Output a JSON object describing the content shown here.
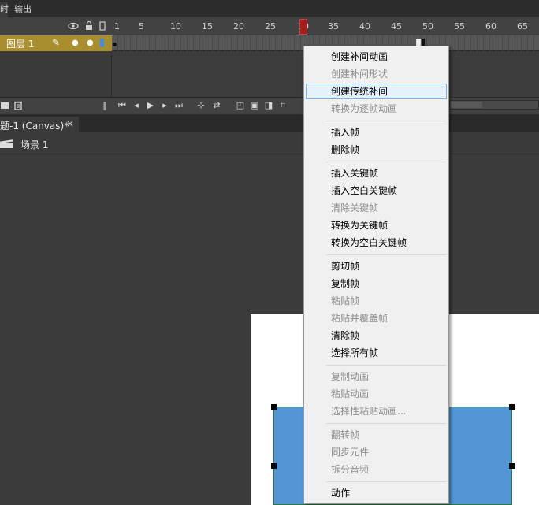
{
  "panel_tabs": {
    "timeline": "时",
    "output": "输出"
  },
  "timeline": {
    "ruler_numbers": [
      "1",
      "5",
      "10",
      "15",
      "20",
      "25",
      "30",
      "35",
      "40",
      "45",
      "50",
      "55",
      "60",
      "65"
    ],
    "header_icons": [
      "eye-icon",
      "lock-icon",
      "outline-icon"
    ],
    "layer": {
      "name": "图层 1"
    }
  },
  "document": {
    "tab_title": "题-1 (Canvas)*",
    "tab_close": "×",
    "scene_label": "场景 1"
  },
  "context_menu": {
    "groups": [
      [
        {
          "label": "创建补间动画",
          "disabled": false
        },
        {
          "label": "创建补间形状",
          "disabled": true
        },
        {
          "label": "创建传统补间",
          "disabled": false,
          "hover": true
        },
        {
          "label": "转换为逐帧动画",
          "disabled": true
        }
      ],
      [
        {
          "label": "插入帧",
          "disabled": false
        },
        {
          "label": "删除帧",
          "disabled": false
        }
      ],
      [
        {
          "label": "插入关键帧",
          "disabled": false
        },
        {
          "label": "插入空白关键帧",
          "disabled": false
        },
        {
          "label": "清除关键帧",
          "disabled": true
        },
        {
          "label": "转换为关键帧",
          "disabled": false
        },
        {
          "label": "转换为空白关键帧",
          "disabled": false
        }
      ],
      [
        {
          "label": "剪切帧",
          "disabled": false
        },
        {
          "label": "复制帧",
          "disabled": false
        },
        {
          "label": "粘贴帧",
          "disabled": true
        },
        {
          "label": "粘贴并覆盖帧",
          "disabled": true
        },
        {
          "label": "清除帧",
          "disabled": false
        },
        {
          "label": "选择所有帧",
          "disabled": false
        }
      ],
      [
        {
          "label": "复制动画",
          "disabled": true
        },
        {
          "label": "粘贴动画",
          "disabled": true
        },
        {
          "label": "选择性粘贴动画...",
          "disabled": true
        }
      ],
      [
        {
          "label": "翻转帧",
          "disabled": true
        },
        {
          "label": "同步元件",
          "disabled": true
        },
        {
          "label": "拆分音频",
          "disabled": true
        }
      ],
      [
        {
          "label": "动作",
          "disabled": false
        }
      ]
    ]
  },
  "colors": {
    "layer_highlight": "#a88e2e",
    "playhead": "#a02020",
    "shape_fill": "#5495d6",
    "menu_hover": "#e5f1fb"
  }
}
